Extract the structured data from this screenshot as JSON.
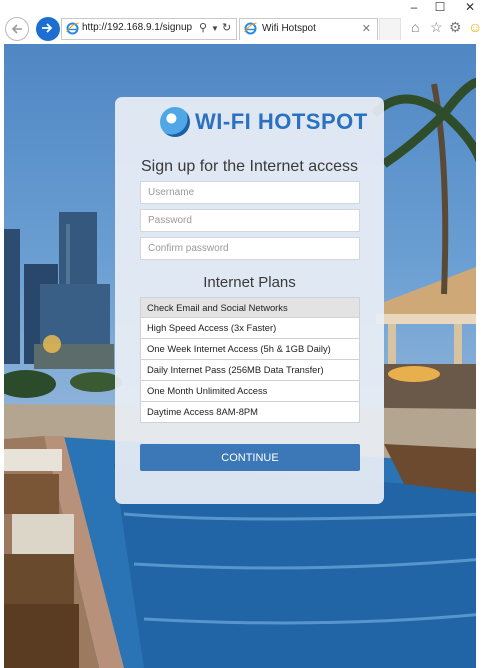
{
  "browser": {
    "url": "http://192.168.9.1/signup",
    "tab_title": "Wifi Hotspot",
    "window_controls": [
      "–",
      "☐",
      "✕"
    ]
  },
  "brand": {
    "name": "WI-FI HOTSPOT",
    "color": "#2b71c1"
  },
  "signup": {
    "heading": "Sign up for the Internet access",
    "username_placeholder": "Username",
    "password_placeholder": "Password",
    "confirm_placeholder": "Confirm password"
  },
  "plans": {
    "heading": "Internet Plans",
    "items": [
      {
        "label": "Check Email and Social Networks",
        "selected": true
      },
      {
        "label": "High Speed Access (3x Faster)",
        "selected": false
      },
      {
        "label": "One Week Internet Access (5h & 1GB Daily)",
        "selected": false
      },
      {
        "label": "Daily Internet Pass (256MB Data Transfer)",
        "selected": false
      },
      {
        "label": "One Month Unlimited Access",
        "selected": false
      },
      {
        "label": "Daytime Access 8AM-8PM",
        "selected": false
      }
    ]
  },
  "cta": {
    "label": "CONTINUE",
    "color": "#3c78b8"
  }
}
